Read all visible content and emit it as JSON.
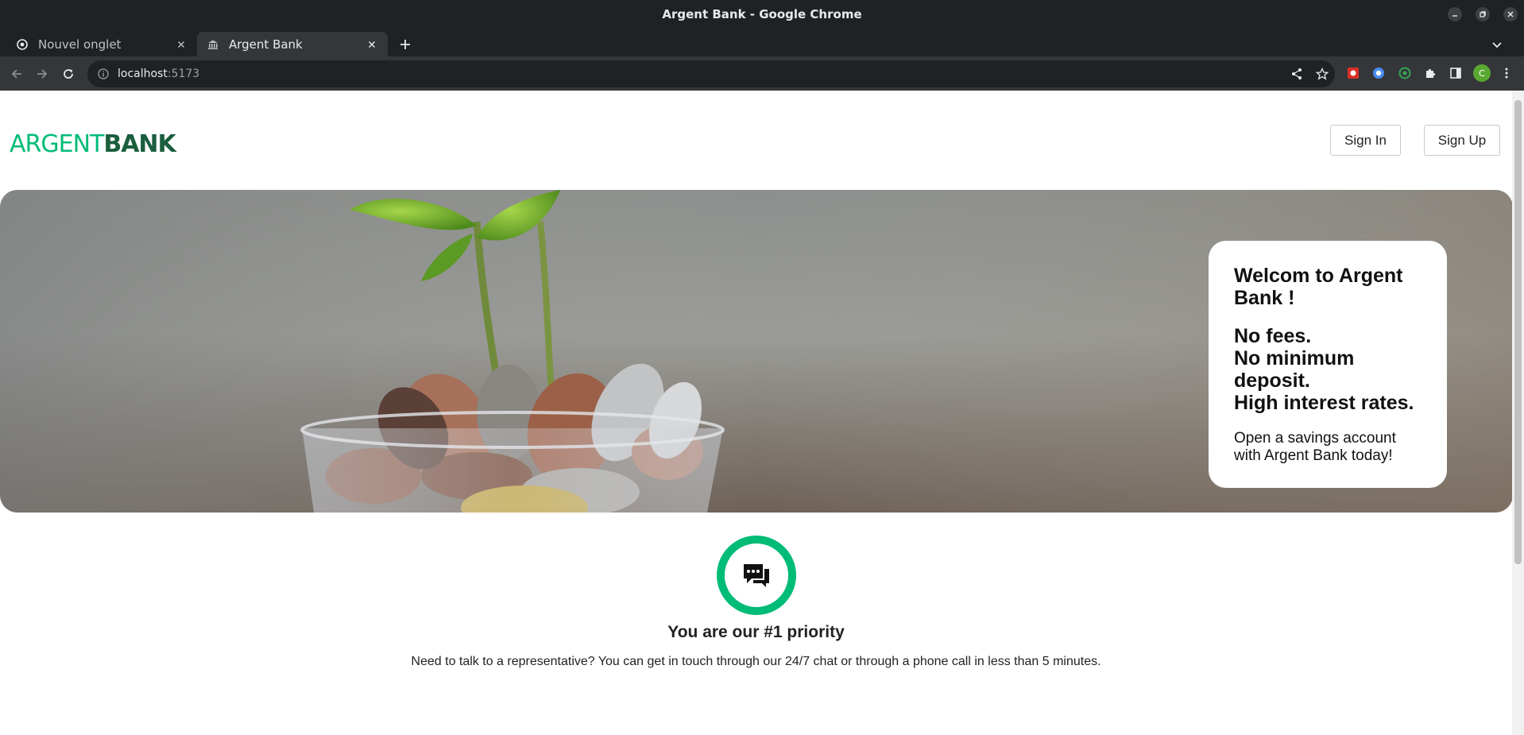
{
  "window": {
    "title": "Argent Bank - Google Chrome"
  },
  "tabs": [
    {
      "label": "Nouvel onglet",
      "icon": "chrome-icon",
      "active": false
    },
    {
      "label": "Argent Bank",
      "icon": "bank-icon",
      "active": true
    }
  ],
  "address_bar": {
    "host": "localhost",
    "port": ":5173"
  },
  "profile": {
    "initial": "C"
  },
  "colors": {
    "brand_green": "#00bc77",
    "brand_dark_green": "#1b5e3e",
    "chrome_dark": "#202124",
    "chrome_toolbar": "#35363a"
  },
  "site": {
    "logo": {
      "part1": "ARGENT",
      "part2": "BANK"
    },
    "nav": {
      "sign_in": "Sign In",
      "sign_up": "Sign Up"
    },
    "hero": {
      "title": "Welcom to Argent Bank !",
      "taglines": [
        "No fees.",
        "No minimum deposit.",
        "High interest rates."
      ],
      "cta": "Open a savings account with Argent Bank today!"
    },
    "feature": {
      "icon": "chat-icon",
      "title": "You are our #1 priority",
      "text": "Need to talk to a representative? You can get in touch through our 24/7 chat or through a phone call in less than 5 minutes."
    }
  }
}
